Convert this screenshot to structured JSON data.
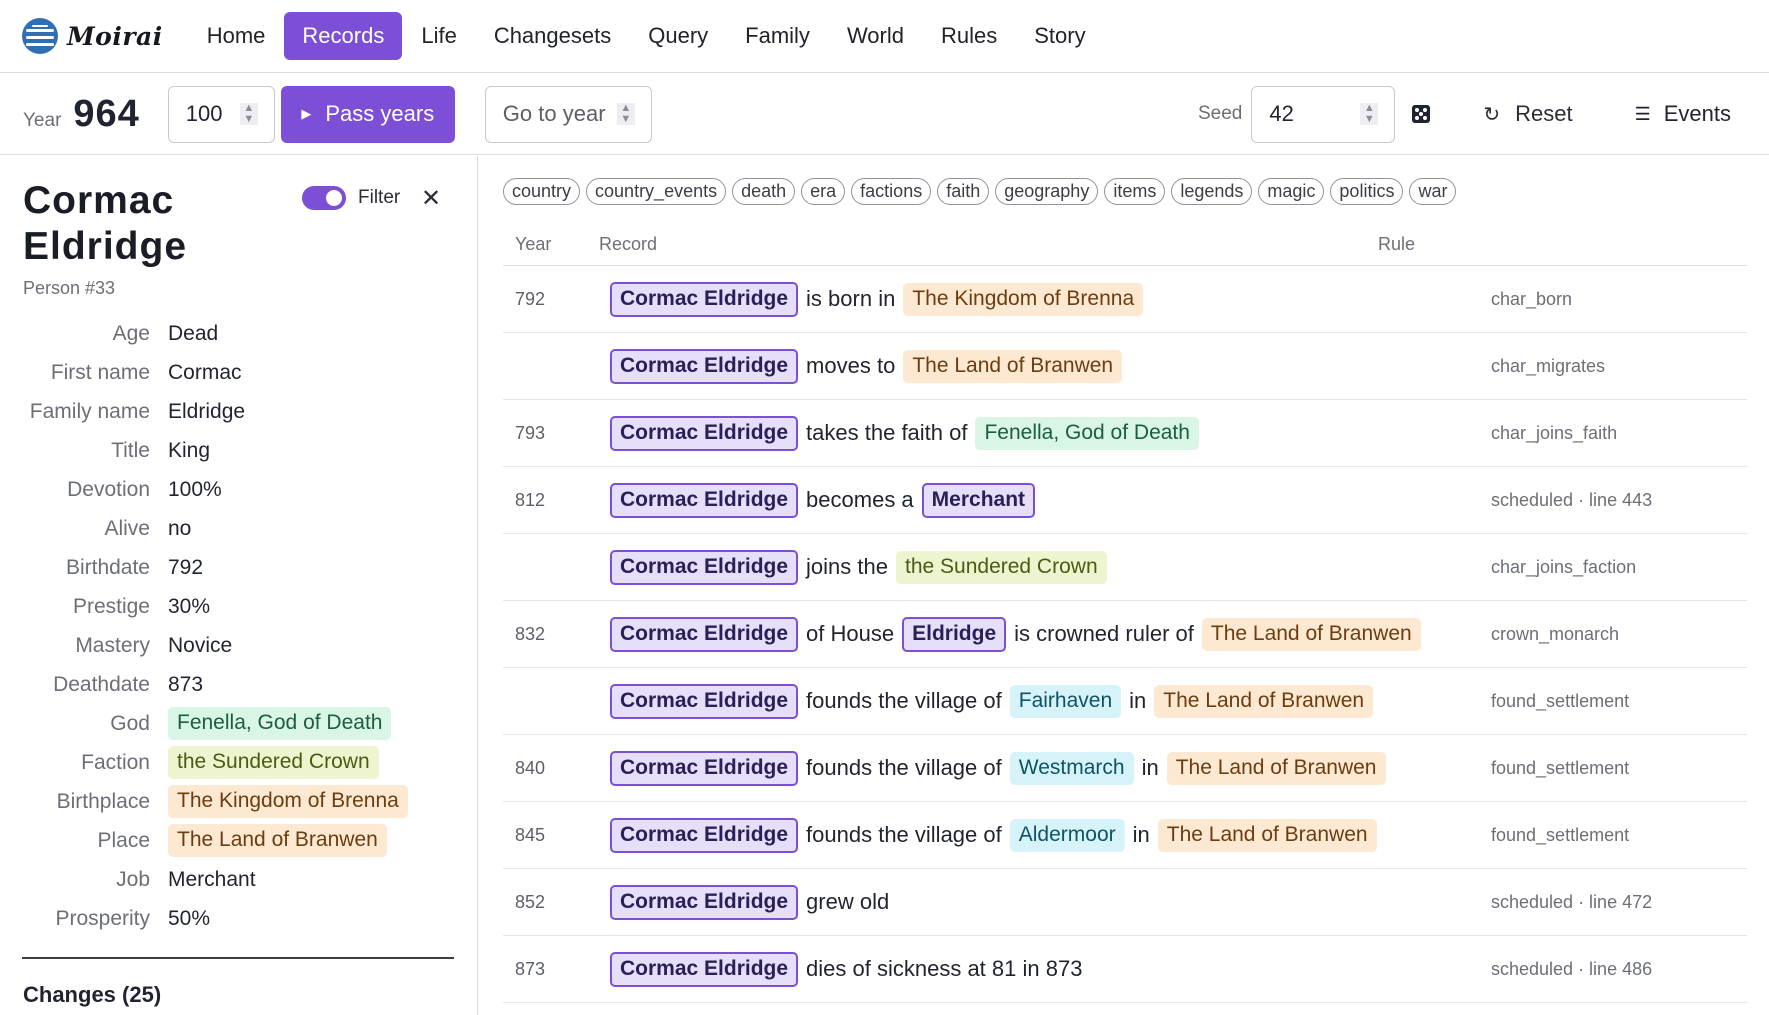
{
  "brand": {
    "name": "Moirai"
  },
  "nav": {
    "items": [
      "Home",
      "Records",
      "Life",
      "Changesets",
      "Query",
      "Family",
      "World",
      "Rules",
      "Story"
    ],
    "active": "Records"
  },
  "toolbar": {
    "year_label": "Year",
    "year_value": "964",
    "years_to_pass": "100",
    "pass_label": "Pass years",
    "goto_placeholder": "Go to year",
    "seed_label": "Seed",
    "seed_value": "42",
    "reset_label": "Reset",
    "events_label": "Events"
  },
  "person": {
    "name": "Cormac Eldridge",
    "id_label": "Person #33",
    "filter_label": "Filter",
    "filter_on": true,
    "attributes": [
      {
        "label": "Age",
        "value": "Dead",
        "kind": "text"
      },
      {
        "label": "First name",
        "value": "Cormac",
        "kind": "text"
      },
      {
        "label": "Family name",
        "value": "Eldridge",
        "kind": "text"
      },
      {
        "label": "Title",
        "value": "King",
        "kind": "text"
      },
      {
        "label": "Devotion",
        "value": "100%",
        "kind": "text"
      },
      {
        "label": "Alive",
        "value": "no",
        "kind": "text"
      },
      {
        "label": "Birthdate",
        "value": "792",
        "kind": "text"
      },
      {
        "label": "Prestige",
        "value": "30%",
        "kind": "text"
      },
      {
        "label": "Mastery",
        "value": "Novice",
        "kind": "text"
      },
      {
        "label": "Deathdate",
        "value": "873",
        "kind": "text"
      },
      {
        "label": "God",
        "value": "Fenella, God of Death",
        "kind": "faith"
      },
      {
        "label": "Faction",
        "value": "the Sundered Crown",
        "kind": "faction"
      },
      {
        "label": "Birthplace",
        "value": "The Kingdom of Brenna",
        "kind": "place"
      },
      {
        "label": "Place",
        "value": "The Land of Branwen",
        "kind": "place"
      },
      {
        "label": "Job",
        "value": "Merchant",
        "kind": "text"
      },
      {
        "label": "Prosperity",
        "value": "50%",
        "kind": "text"
      }
    ],
    "changes_label": "Changes (25)"
  },
  "tags": [
    "country",
    "country_events",
    "death",
    "era",
    "factions",
    "faith",
    "geography",
    "items",
    "legends",
    "magic",
    "politics",
    "war"
  ],
  "table": {
    "headers": {
      "year": "Year",
      "record": "Record",
      "rule": "Rule"
    },
    "rows": [
      {
        "year": "792",
        "rule": "char_born",
        "parts": [
          {
            "t": "Cormac Eldridge",
            "k": "person"
          },
          {
            "t": "is born in",
            "k": "text"
          },
          {
            "t": "The Kingdom of Brenna",
            "k": "place"
          }
        ]
      },
      {
        "year": "",
        "rule": "char_migrates",
        "parts": [
          {
            "t": "Cormac Eldridge",
            "k": "person"
          },
          {
            "t": "moves to",
            "k": "text"
          },
          {
            "t": "The Land of Branwen",
            "k": "place"
          }
        ]
      },
      {
        "year": "793",
        "rule": "char_joins_faith",
        "parts": [
          {
            "t": "Cormac Eldridge",
            "k": "person"
          },
          {
            "t": "takes the faith of",
            "k": "text"
          },
          {
            "t": "Fenella, God of Death",
            "k": "faith"
          }
        ]
      },
      {
        "year": "812",
        "rule": "scheduled · line 443",
        "parts": [
          {
            "t": "Cormac Eldridge",
            "k": "person"
          },
          {
            "t": "becomes a",
            "k": "text"
          },
          {
            "t": "Merchant",
            "k": "person"
          }
        ]
      },
      {
        "year": "",
        "rule": "char_joins_faction",
        "parts": [
          {
            "t": "Cormac Eldridge",
            "k": "person"
          },
          {
            "t": "joins the",
            "k": "text"
          },
          {
            "t": "the Sundered Crown",
            "k": "faction"
          }
        ]
      },
      {
        "year": "832",
        "rule": "crown_monarch",
        "parts": [
          {
            "t": "Cormac Eldridge",
            "k": "person"
          },
          {
            "t": "of House",
            "k": "text"
          },
          {
            "t": "Eldridge",
            "k": "person"
          },
          {
            "t": "is crowned ruler of",
            "k": "text"
          },
          {
            "t": "The Land of Branwen",
            "k": "place"
          }
        ]
      },
      {
        "year": "",
        "rule": "found_settlement",
        "parts": [
          {
            "t": "Cormac Eldridge",
            "k": "person"
          },
          {
            "t": "founds the village of",
            "k": "text"
          },
          {
            "t": "Fairhaven",
            "k": "settlement"
          },
          {
            "t": "in",
            "k": "text"
          },
          {
            "t": "The Land of Branwen",
            "k": "place"
          }
        ]
      },
      {
        "year": "840",
        "rule": "found_settlement",
        "parts": [
          {
            "t": "Cormac Eldridge",
            "k": "person"
          },
          {
            "t": "founds the village of",
            "k": "text"
          },
          {
            "t": "Westmarch",
            "k": "settlement"
          },
          {
            "t": "in",
            "k": "text"
          },
          {
            "t": "The Land of Branwen",
            "k": "place"
          }
        ]
      },
      {
        "year": "845",
        "rule": "found_settlement",
        "parts": [
          {
            "t": "Cormac Eldridge",
            "k": "person"
          },
          {
            "t": "founds the village of",
            "k": "text"
          },
          {
            "t": "Aldermoor",
            "k": "settlement"
          },
          {
            "t": "in",
            "k": "text"
          },
          {
            "t": "The Land of Branwen",
            "k": "place"
          }
        ]
      },
      {
        "year": "852",
        "rule": "scheduled · line 472",
        "parts": [
          {
            "t": "Cormac Eldridge",
            "k": "person"
          },
          {
            "t": "grew old",
            "k": "text"
          }
        ]
      },
      {
        "year": "873",
        "rule": "scheduled · line 486",
        "parts": [
          {
            "t": "Cormac Eldridge",
            "k": "person"
          },
          {
            "t": "dies of sickness at 81 in 873",
            "k": "text"
          }
        ]
      }
    ]
  },
  "colors": {
    "accent": "#7d4fd6",
    "place": "#fde8d2",
    "faith": "#d9f5e5",
    "faction": "#ecf5d0",
    "settlement": "#d6f3fa"
  },
  "icons": {
    "logo": "globe-logo-icon",
    "play": "play-icon",
    "dice": "dice-icon",
    "reset": "reset-icon",
    "events": "list-icon",
    "close": "close-icon"
  }
}
